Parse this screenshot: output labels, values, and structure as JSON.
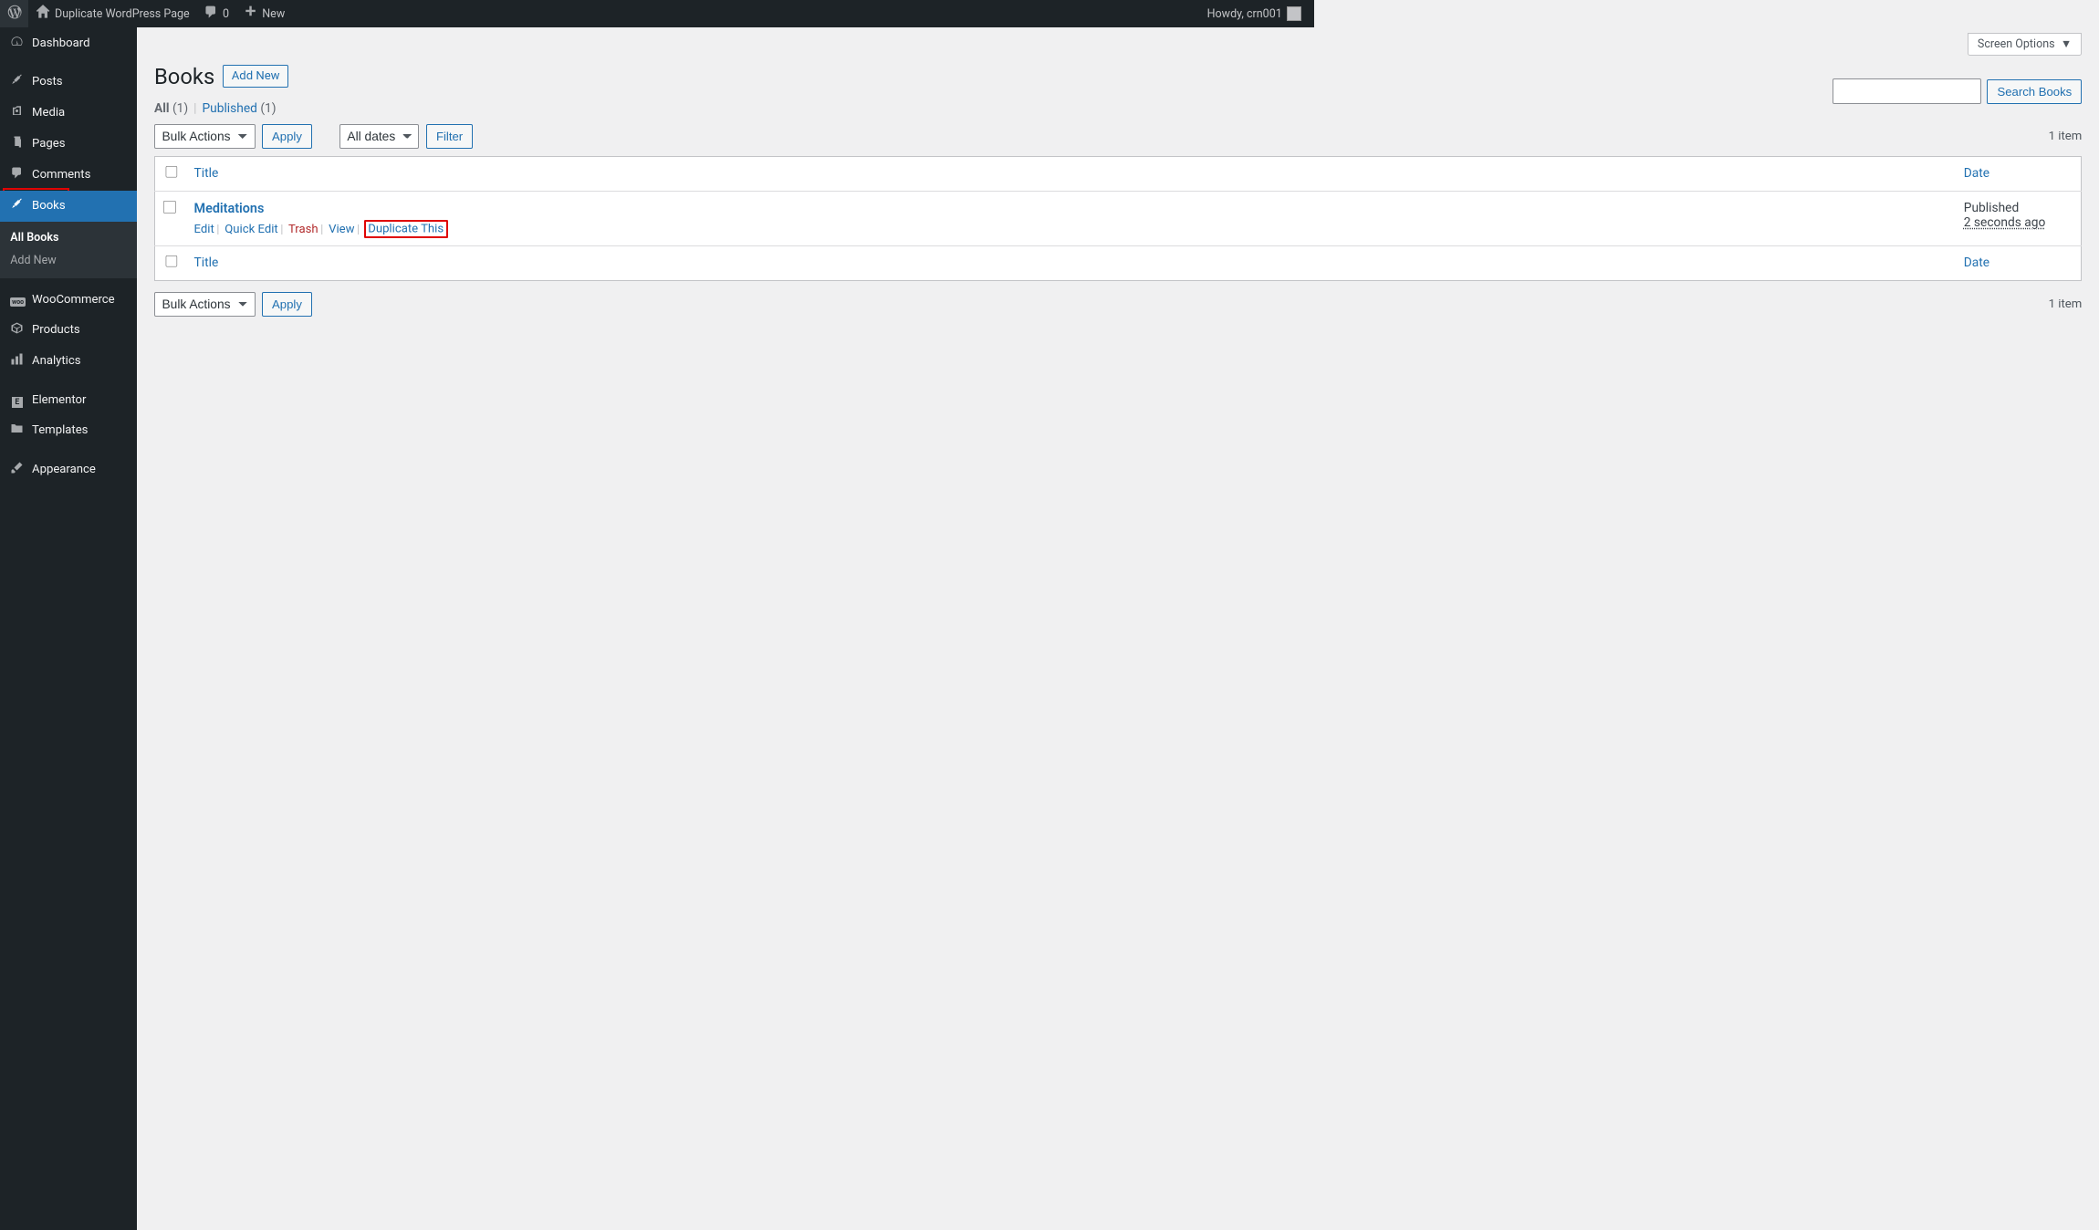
{
  "adminbar": {
    "site_title": "Duplicate WordPress Page",
    "comments_count": "0",
    "new_label": "New",
    "howdy": "Howdy, crn001"
  },
  "sidebar": {
    "items": [
      {
        "label": "Dashboard"
      },
      {
        "label": "Posts"
      },
      {
        "label": "Media"
      },
      {
        "label": "Pages"
      },
      {
        "label": "Comments"
      },
      {
        "label": "Books"
      },
      {
        "label": "WooCommerce"
      },
      {
        "label": "Products"
      },
      {
        "label": "Analytics"
      },
      {
        "label": "Elementor"
      },
      {
        "label": "Templates"
      },
      {
        "label": "Appearance"
      }
    ],
    "submenu": {
      "all": "All Books",
      "add": "Add New"
    }
  },
  "screen_options": "Screen Options",
  "page_title": "Books",
  "add_new": "Add New",
  "filters": {
    "all_label": "All",
    "all_count": "(1)",
    "published_label": "Published",
    "published_count": "(1)"
  },
  "bulk_actions": "Bulk Actions",
  "apply": "Apply",
  "all_dates": "All dates",
  "filter": "Filter",
  "search_button": "Search Books",
  "items_count": "1 item",
  "columns": {
    "title": "Title",
    "date": "Date"
  },
  "row": {
    "title": "Meditations",
    "actions": {
      "edit": "Edit",
      "quick": "Quick Edit",
      "trash": "Trash",
      "view": "View",
      "dup": "Duplicate This"
    },
    "status": "Published",
    "date": "2 seconds ago"
  }
}
